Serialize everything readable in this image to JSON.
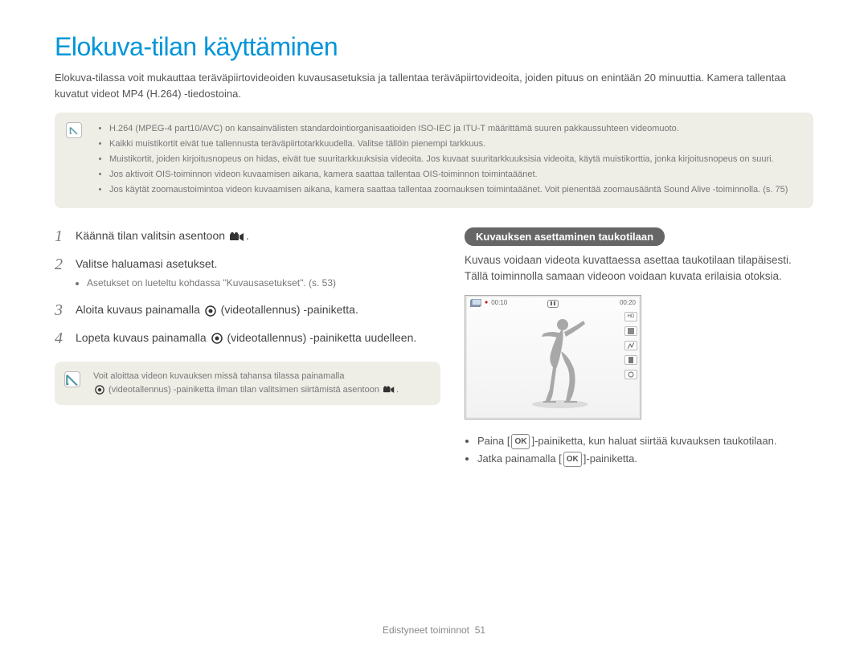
{
  "title": "Elokuva-tilan käyttäminen",
  "intro": "Elokuva-tilassa voit mukauttaa teräväpiirtovideoiden kuvausasetuksia ja tallentaa teräväpiirtovideoita, joiden pituus on enintään 20 minuuttia. Kamera tallentaa kuvatut videot MP4 (H.264) -tiedostoina.",
  "notes": {
    "items": [
      "H.264 (MPEG-4 part10/AVC) on kansainvälisten standardointiorganisaatioiden ISO-IEC ja ITU-T määrittämä suuren pakkaussuhteen videomuoto.",
      "Kaikki muistikortit eivät tue tallennusta teräväpiirtotarkkuudella. Valitse tällöin pienempi tarkkuus.",
      "Muistikortit, joiden kirjoitusnopeus on hidas, eivät tue suuritarkkuuksisia videoita. Jos kuvaat suuritarkkuuksisia videoita, käytä muistikorttia, jonka kirjoitusnopeus on suuri.",
      "Jos aktivoit OIS-toiminnon videon kuvaamisen aikana, kamera saattaa tallentaa OIS-toiminnon toimintaäänet.",
      "Jos käytät zoomaustoimintoa videon kuvaamisen aikana, kamera saattaa tallentaa zoomauksen toimintaäänet. Voit pienentää zoomausääntä Sound Alive -toiminnolla. (s. 75)"
    ]
  },
  "steps": {
    "s1_a": "Käännä tilan valitsin asentoon ",
    "s1_b": ".",
    "s2": "Valitse haluamasi asetukset.",
    "s2_sub": "Asetukset on lueteltu kohdassa \"Kuvausasetukset\". (s. 53)",
    "s3_a": "Aloita kuvaus painamalla ",
    "s3_b": " (videotallennus) -painiketta.",
    "s4_a": "Lopeta kuvaus painamalla ",
    "s4_b": " (videotallennus) -painiketta uudelleen."
  },
  "mini_note": {
    "line1": "Voit aloittaa videon kuvauksen missä tahansa tilassa painamalla",
    "line2_a": " (videotallennus) -painiketta ilman tilan valitsimen siirtämistä asentoon ",
    "line2_b": "."
  },
  "right": {
    "pill": "Kuvauksen asettaminen taukotilaan",
    "para": "Kuvaus voidaan videota kuvattaessa asettaa taukotilaan tilapäisesti. Tällä toiminnolla samaan videoon voidaan kuvata erilaisia otoksia.",
    "lcd": {
      "rec_time": "00:10",
      "total_time": "00:20",
      "hd": "HD"
    },
    "bullets": {
      "b1_a": "Paina [",
      "b1_b": "]-painiketta, kun haluat siirtää kuvauksen taukotilaan.",
      "b2_a": "Jatka painamalla [",
      "b2_b": "]-painiketta."
    },
    "ok_label": "OK"
  },
  "footer": {
    "section": "Edistyneet toiminnot",
    "page": "51"
  }
}
